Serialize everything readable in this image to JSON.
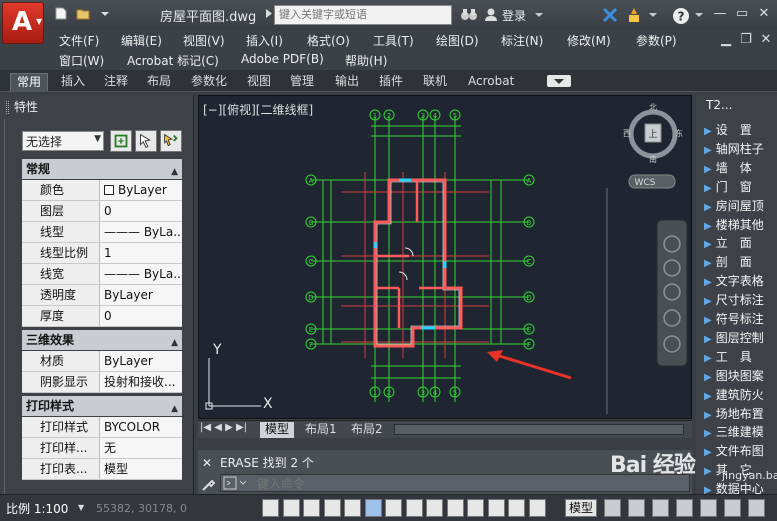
{
  "app": {
    "logo_letter": "A",
    "document_title": "房屋平面图.dwg",
    "search_placeholder": "键入关键字或短语",
    "login_label": "登录",
    "help_label": "?"
  },
  "menubar": {
    "row1": [
      "文件(F)",
      "编辑(E)",
      "视图(V)",
      "插入(I)",
      "格式(O)",
      "工具(T)",
      "绘图(D)",
      "标注(N)",
      "修改(M)",
      "参数(P)"
    ],
    "row2": [
      "窗口(W)",
      "Acrobat 标记(C)",
      "Adobe PDF(B)",
      "帮助(H)"
    ]
  },
  "ribbon": {
    "tabs": [
      "常用",
      "插入",
      "注释",
      "布局",
      "参数化",
      "视图",
      "管理",
      "输出",
      "插件",
      "联机",
      "Acrobat"
    ],
    "active_index": 0
  },
  "properties": {
    "title": "特性",
    "selection": "无选择",
    "sections": [
      {
        "name": "常规",
        "rows": [
          {
            "label": "颜色",
            "value": "ByLayer",
            "swatch": true
          },
          {
            "label": "图层",
            "value": "0"
          },
          {
            "label": "线型",
            "value": "——— ByLa..."
          },
          {
            "label": "线型比例",
            "value": "1"
          },
          {
            "label": "线宽",
            "value": "——— ByLa..."
          },
          {
            "label": "透明度",
            "value": "ByLayer"
          },
          {
            "label": "厚度",
            "value": "0"
          }
        ]
      },
      {
        "name": "三维效果",
        "rows": [
          {
            "label": "材质",
            "value": "ByLayer"
          },
          {
            "label": "阴影显示",
            "value": "投射和接收..."
          }
        ]
      },
      {
        "name": "打印样式",
        "rows": [
          {
            "label": "打印样式",
            "value": "BYCOLOR"
          },
          {
            "label": "打印样...",
            "value": "无"
          },
          {
            "label": "打印表...",
            "value": "模型"
          }
        ]
      }
    ]
  },
  "canvas": {
    "view_label": "[−][俯视][二维线框]",
    "compass": {
      "north": "北",
      "south": "南",
      "west": "西",
      "east": "东",
      "center": "上"
    },
    "wcs_label": "WCS",
    "ucs_y": "Y",
    "ucs_x": "X",
    "grid_top_labels": [
      "①",
      "②",
      "③",
      "④",
      "⑤"
    ],
    "grid_side_labels": [
      "A",
      "B",
      "C",
      "D",
      "E",
      "F"
    ]
  },
  "layout_tabs": [
    "模型",
    "布局1",
    "布局2"
  ],
  "command": {
    "history": "ERASE  找到 2 个",
    "input_placeholder": "键入命令"
  },
  "palette": {
    "title": "T2...",
    "items": [
      "设　置",
      "轴网柱子",
      "墙　体",
      "门　窗",
      "房间屋顶",
      "楼梯其他",
      "立　面",
      "剖　面",
      "文字表格",
      "尺寸标注",
      "符号标注",
      "图层控制",
      "工　具",
      "图块图案",
      "建筑防火",
      "场地布置",
      "三维建模",
      "文件布图",
      "其　它",
      "数据中心"
    ]
  },
  "statusbar": {
    "scale": "比例 1:100",
    "coords": "55382, 30178, 0",
    "model_label": "模型"
  },
  "watermark": {
    "brand": "Bai 经验",
    "sub": "jingyan.baidu.com"
  },
  "colors": {
    "canvas_bg": "#1f2632",
    "wall": "#ff5b5b",
    "axis": "#33d633",
    "window": "#2ad4ff",
    "arrow": "#e8322a",
    "logo": "#d8261a"
  }
}
